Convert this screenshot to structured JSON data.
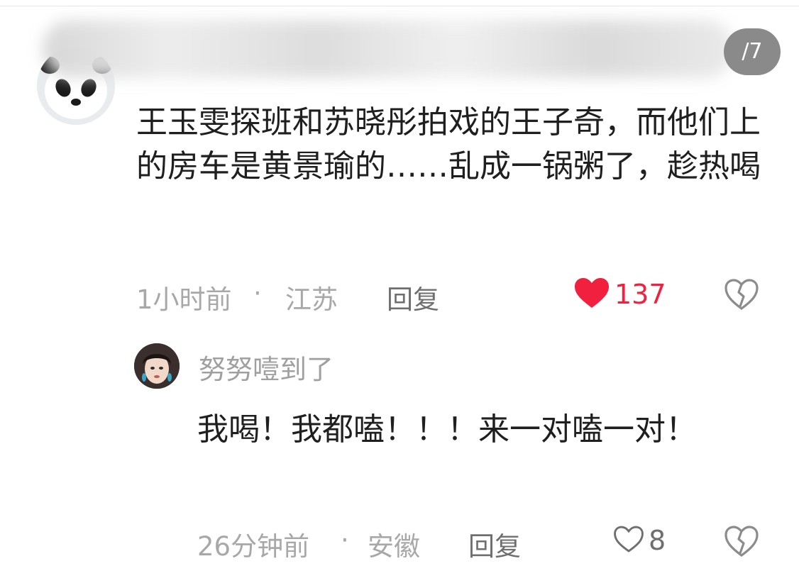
{
  "pager": {
    "counter": "/7"
  },
  "main_comment": {
    "text": "王玉雯探班和苏晓彤拍戏的王子奇，而他们上的房车是黄景瑜的……乱成一锅粥了，趁热喝",
    "time": "1小时前",
    "separator": "·",
    "location": "江苏",
    "reply_label": "回复",
    "likes": "137",
    "liked": true,
    "like_color": "#f0203e"
  },
  "reply_comment": {
    "username": "努努噎到了",
    "text": "我喝！我都嗑！！！来一对嗑一对！",
    "time": "26分钟前",
    "separator": "·",
    "location": "安徽",
    "reply_label": "回复",
    "likes": "8",
    "liked": false
  },
  "icons": {
    "like_filled": "heart-filled-icon",
    "like_outline": "heart-outline-icon",
    "dislike": "broken-heart-icon"
  }
}
